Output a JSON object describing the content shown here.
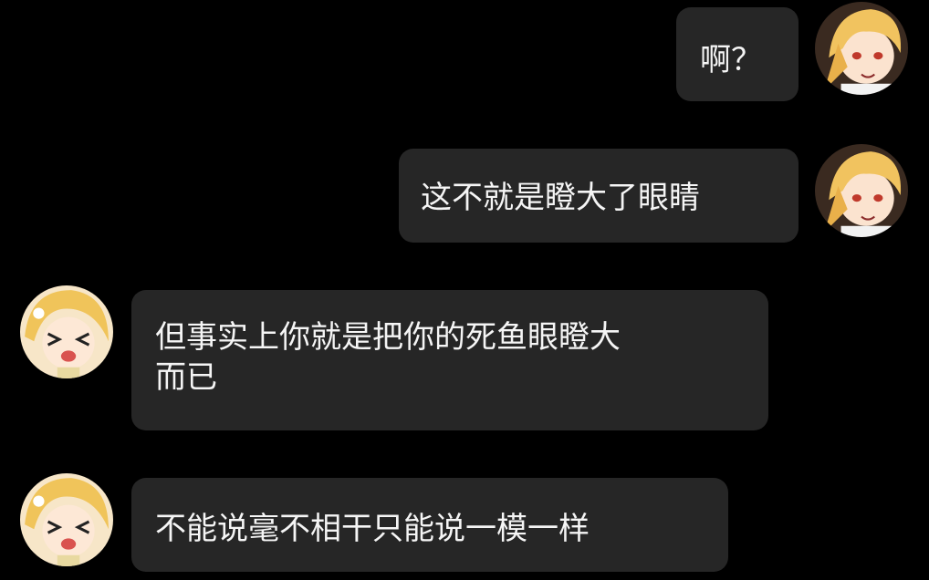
{
  "messages": [
    {
      "side": "right",
      "sender": "blonde-boy",
      "text": "啊？"
    },
    {
      "side": "right",
      "sender": "blonde-boy",
      "text": "这不就是瞪大了眼睛"
    },
    {
      "side": "left",
      "sender": "blonde-girl",
      "text_line1": "但事实上你就是把你的死鱼眼瞪大",
      "text_line2": "而已"
    },
    {
      "side": "left",
      "sender": "blonde-girl",
      "text": "不能说毫不相干只能说一模一样"
    }
  ],
  "colors": {
    "background": "#000000",
    "bubble": "#262626",
    "text": "#f5f5f5"
  }
}
